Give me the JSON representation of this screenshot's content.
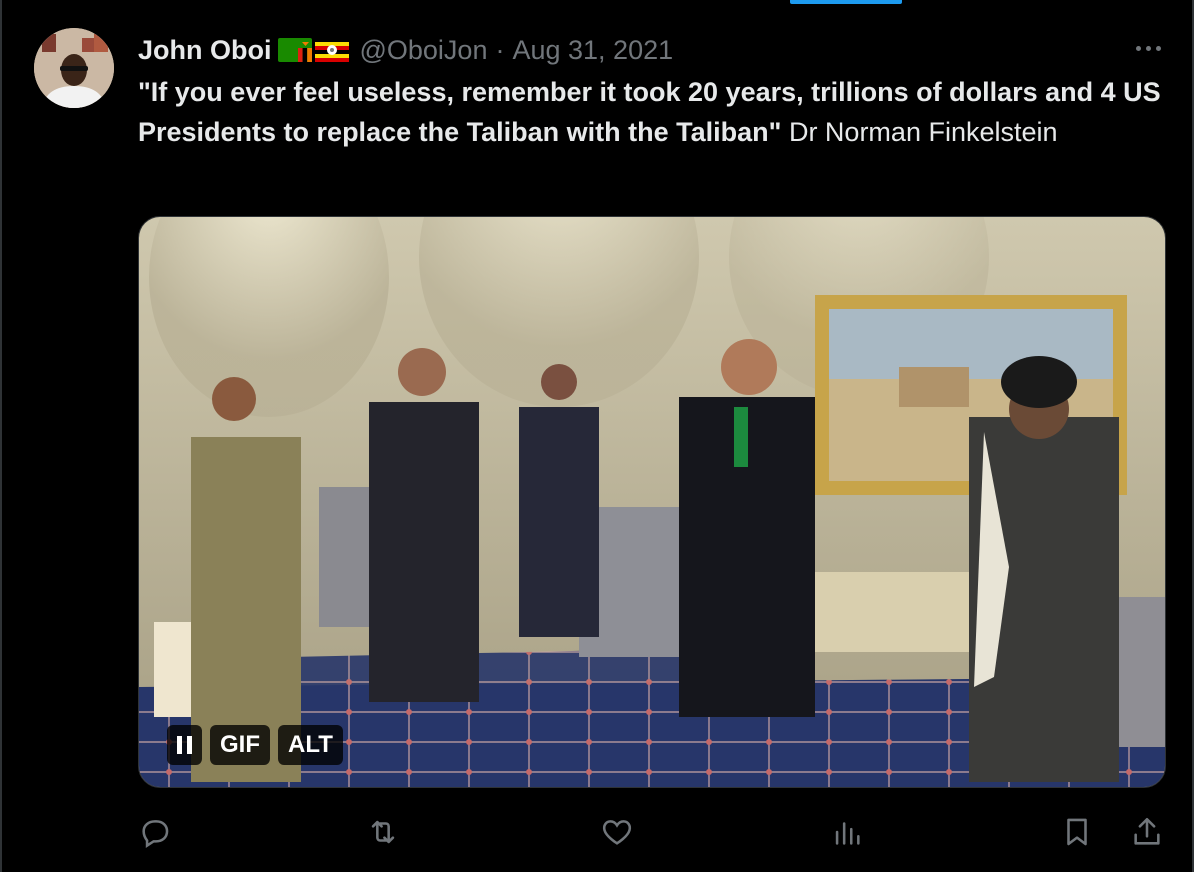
{
  "tweet": {
    "author_name": "John Oboi",
    "author_flags": [
      "flag-zambia",
      "flag-uganda"
    ],
    "handle": "@OboiJon",
    "separator": "·",
    "date": "Aug 31, 2021",
    "text_bold": "\"If you ever feel useless, remember it took 20 years, trillions of dollars and 4 US Presidents to replace the Taliban with the Taliban\"",
    "text_plain": " Dr Norman Finkelstein"
  },
  "media": {
    "type": "gif",
    "controls": {
      "pause_icon": "pause-icon",
      "gif_label": "GIF",
      "alt_label": "ALT"
    }
  },
  "actions": {
    "reply_icon": "reply-icon",
    "retweet_icon": "retweet-icon",
    "like_icon": "heart-icon",
    "views_icon": "views-icon",
    "bookmark_icon": "bookmark-icon",
    "share_icon": "share-icon"
  },
  "colors": {
    "accent": "#1d9bf0",
    "text": "#e7e9ea",
    "muted": "#71767b",
    "background": "#000000"
  }
}
